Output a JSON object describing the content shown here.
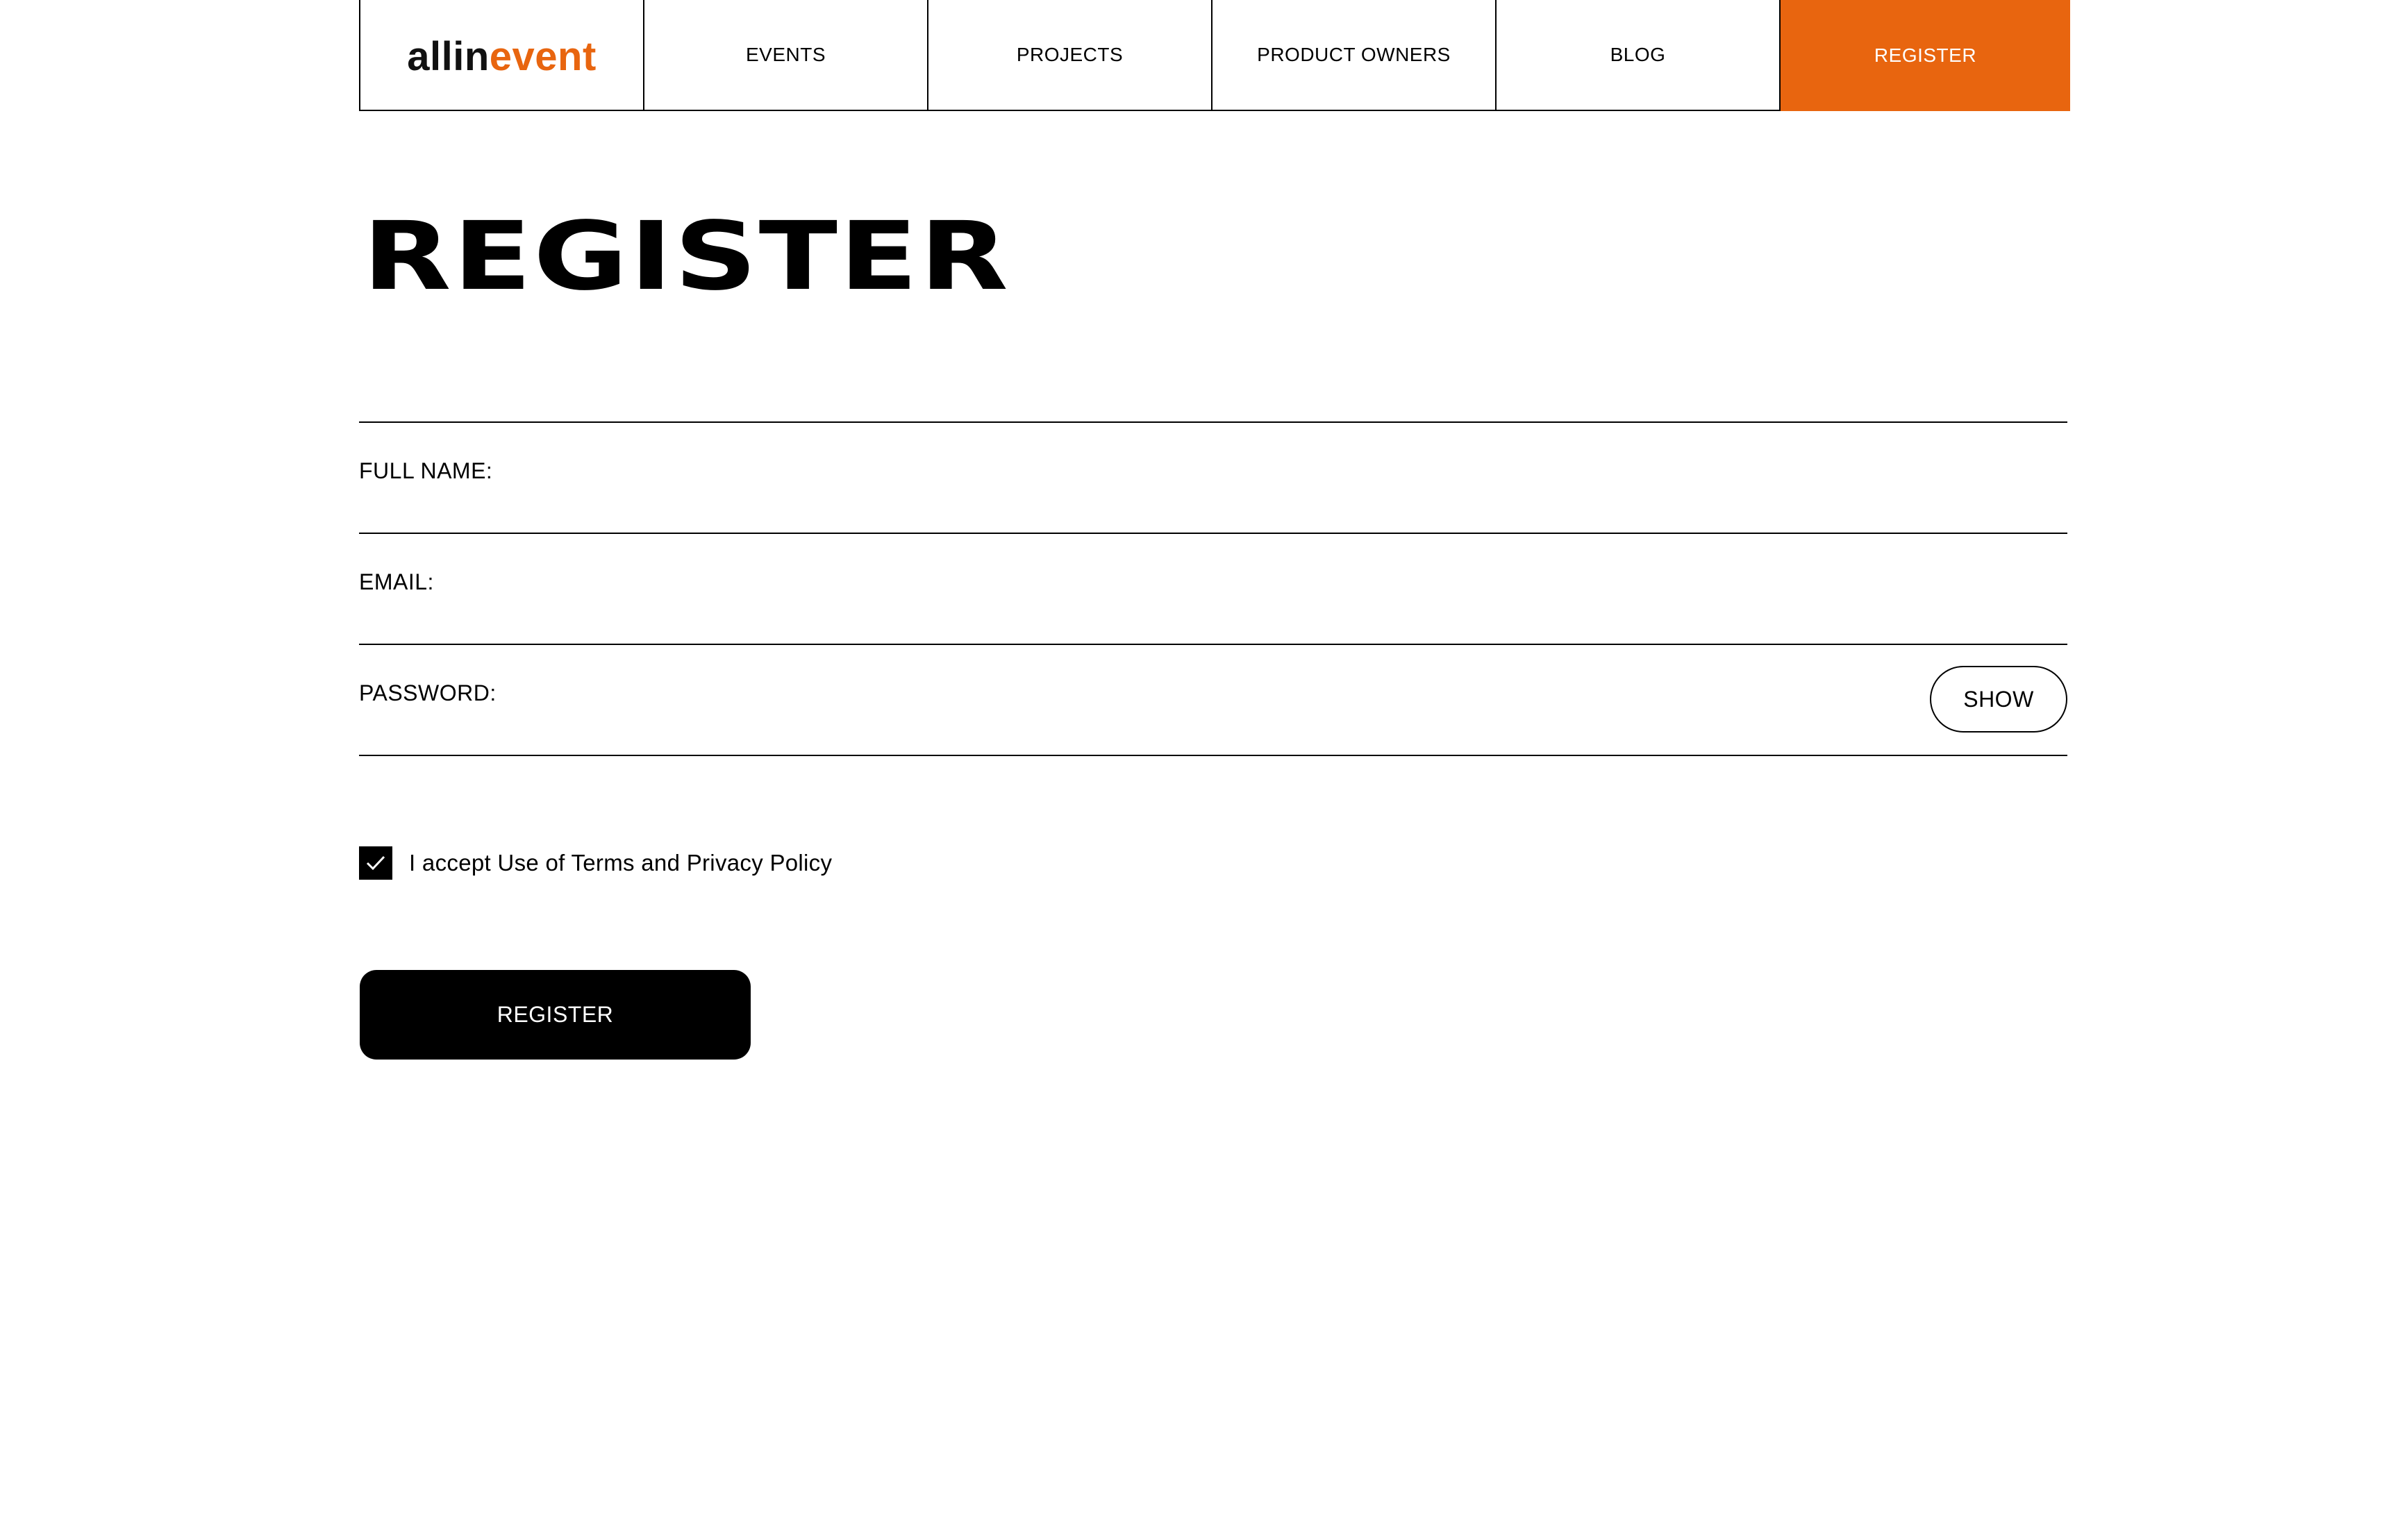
{
  "brand": {
    "logo_part1": "allin",
    "logo_part2": "event",
    "accent_color": "#e8650f"
  },
  "nav": {
    "items": [
      {
        "label": "EVENTS"
      },
      {
        "label": "PROJECTS"
      },
      {
        "label": "PRODUCT OWNERS"
      },
      {
        "label": "BLOG"
      }
    ],
    "register_label": "REGISTER"
  },
  "page": {
    "title": "REGISTER"
  },
  "form": {
    "full_name": {
      "label": "FULL NAME:",
      "value": ""
    },
    "email": {
      "label": "EMAIL:",
      "value": ""
    },
    "password": {
      "label": "PASSWORD:",
      "value": "",
      "show_label": "SHOW"
    },
    "terms": {
      "label": "I accept Use of Terms and Privacy Policy",
      "checked": true,
      "icon": "checkmark-icon"
    },
    "submit_label": "REGISTER"
  }
}
